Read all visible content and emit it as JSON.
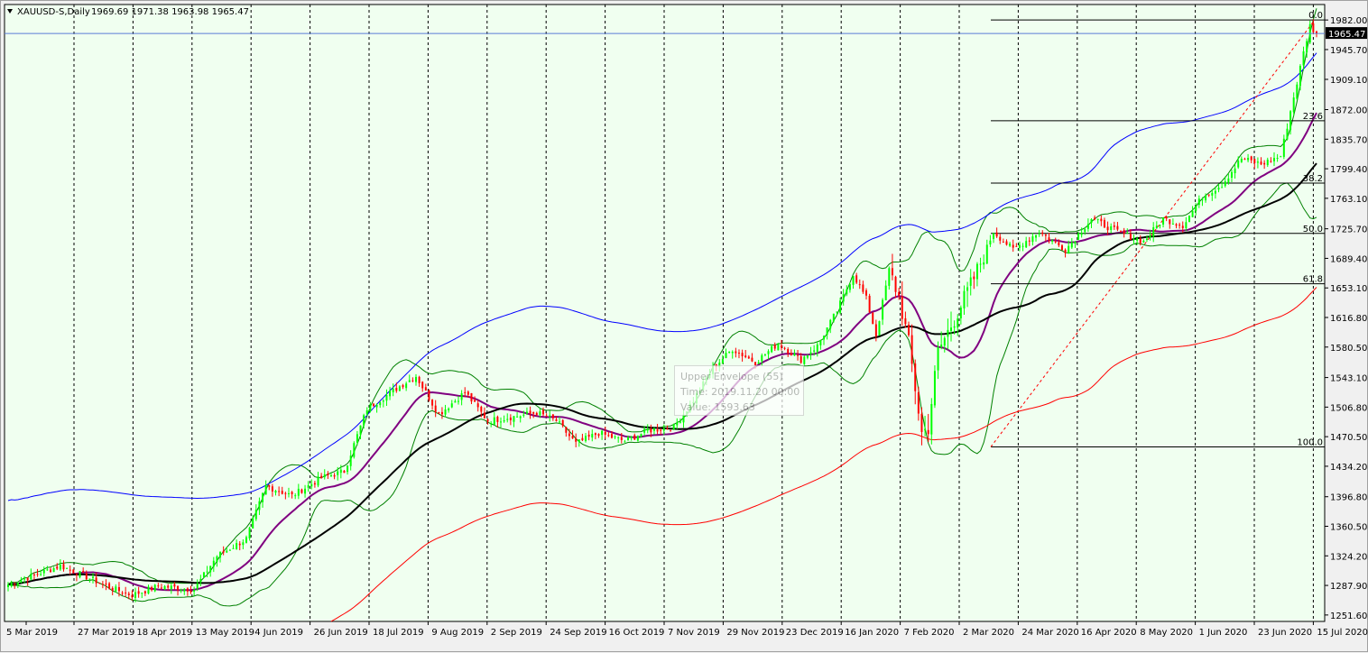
{
  "window": {
    "title": "XAUUSD-S,Daily",
    "ohlc": "1969.69 1971.38 1963.98 1965.47",
    "triangle_icon": "dropdown-triangle-icon"
  },
  "colors": {
    "background": "#f0fff0",
    "candle_up": "#00ff00",
    "candle_down": "#ff0000",
    "ma_fast": "#800080",
    "ma_slow": "#000000",
    "envelope_upper": "#0000ff",
    "envelope_lower": "#ff0000",
    "bollinger": "#008000",
    "fib": "#000000",
    "trend": "#ff0000",
    "grid": "#000000"
  },
  "tooltip": {
    "line1": "Upper Envelope (55)",
    "line2": "Time: 2019.11.20 00:00",
    "line3": "Value: 1593.63"
  },
  "chart_data": {
    "type": "candlestick",
    "symbol": "XAUUSD-S",
    "timeframe": "Daily",
    "last_price": 1965.47,
    "ylim": [
      1243.7,
      2001.0
    ],
    "price_ticks": [
      1982.0,
      1945.7,
      1909.1,
      1872.0,
      1835.7,
      1799.4,
      1763.1,
      1725.7,
      1689.4,
      1653.1,
      1616.8,
      1580.5,
      1543.1,
      1506.8,
      1470.5,
      1434.2,
      1396.8,
      1360.5,
      1324.2,
      1287.9,
      1251.6
    ],
    "date_labels": [
      "5 Mar 2019",
      "27 Mar 2019",
      "18 Apr 2019",
      "13 May 2019",
      "4 Jun 2019",
      "26 Jun 2019",
      "18 Jul 2019",
      "9 Aug 2019",
      "2 Sep 2019",
      "24 Sep 2019",
      "16 Oct 2019",
      "7 Nov 2019",
      "29 Nov 2019",
      "23 Dec 2019",
      "16 Jan 2020",
      "7 Feb 2020",
      "2 Mar 2020",
      "24 Mar 2020",
      "16 Apr 2020",
      "8 May 2020",
      "1 Jun 2020",
      "23 Jun 2020",
      "15 Jul 2020"
    ],
    "close_anchors": [
      {
        "d": 0,
        "v": 1289
      },
      {
        "d": 16,
        "v": 1312
      },
      {
        "d": 22,
        "v": 1302
      },
      {
        "d": 32,
        "v": 1284
      },
      {
        "d": 38,
        "v": 1276
      },
      {
        "d": 46,
        "v": 1287
      },
      {
        "d": 57,
        "v": 1283
      },
      {
        "d": 64,
        "v": 1324
      },
      {
        "d": 73,
        "v": 1345
      },
      {
        "d": 79,
        "v": 1410
      },
      {
        "d": 87,
        "v": 1398
      },
      {
        "d": 96,
        "v": 1420
      },
      {
        "d": 103,
        "v": 1428
      },
      {
        "d": 110,
        "v": 1505
      },
      {
        "d": 121,
        "v": 1535
      },
      {
        "d": 125,
        "v": 1545
      },
      {
        "d": 132,
        "v": 1498
      },
      {
        "d": 140,
        "v": 1525
      },
      {
        "d": 147,
        "v": 1490
      },
      {
        "d": 155,
        "v": 1495
      },
      {
        "d": 162,
        "v": 1500
      },
      {
        "d": 168,
        "v": 1490
      },
      {
        "d": 174,
        "v": 1462
      },
      {
        "d": 181,
        "v": 1475
      },
      {
        "d": 189,
        "v": 1465
      },
      {
        "d": 196,
        "v": 1478
      },
      {
        "d": 204,
        "v": 1482
      },
      {
        "d": 210,
        "v": 1515
      },
      {
        "d": 216,
        "v": 1555
      },
      {
        "d": 222,
        "v": 1578
      },
      {
        "d": 229,
        "v": 1562
      },
      {
        "d": 236,
        "v": 1585
      },
      {
        "d": 243,
        "v": 1565
      },
      {
        "d": 248,
        "v": 1582
      },
      {
        "d": 254,
        "v": 1625
      },
      {
        "d": 259,
        "v": 1670
      },
      {
        "d": 263,
        "v": 1640
      },
      {
        "d": 266,
        "v": 1595
      },
      {
        "d": 270,
        "v": 1675
      },
      {
        "d": 273,
        "v": 1642
      },
      {
        "d": 276,
        "v": 1585
      },
      {
        "d": 280,
        "v": 1475
      },
      {
        "d": 282,
        "v": 1482
      },
      {
        "d": 285,
        "v": 1575
      },
      {
        "d": 290,
        "v": 1615
      },
      {
        "d": 296,
        "v": 1665
      },
      {
        "d": 302,
        "v": 1722
      },
      {
        "d": 308,
        "v": 1700
      },
      {
        "d": 316,
        "v": 1722
      },
      {
        "d": 324,
        "v": 1700
      },
      {
        "d": 332,
        "v": 1738
      },
      {
        "d": 340,
        "v": 1722
      },
      {
        "d": 348,
        "v": 1710
      },
      {
        "d": 354,
        "v": 1738
      },
      {
        "d": 360,
        "v": 1730
      },
      {
        "d": 366,
        "v": 1765
      },
      {
        "d": 372,
        "v": 1780
      },
      {
        "d": 378,
        "v": 1812
      },
      {
        "d": 384,
        "v": 1805
      },
      {
        "d": 390,
        "v": 1815
      },
      {
        "d": 393,
        "v": 1870
      },
      {
        "d": 395,
        "v": 1905
      },
      {
        "d": 397,
        "v": 1942
      },
      {
        "d": 399,
        "v": 1975
      },
      {
        "d": 401,
        "v": 1965.47
      }
    ],
    "fibonacci": {
      "high": 1982.0,
      "low": 1458.0,
      "levels": [
        {
          "label": "0.0",
          "value": 1982.0
        },
        {
          "label": "23.6",
          "value": 1858.3
        },
        {
          "label": "38.2",
          "value": 1781.8
        },
        {
          "label": "50.0",
          "value": 1720.0
        },
        {
          "label": "61.8",
          "value": 1658.2
        },
        {
          "label": "100.0",
          "value": 1458.0
        }
      ]
    },
    "indicators": [
      "Moving Average (fast)",
      "Moving Average (slow)",
      "Envelopes (55)",
      "Bollinger Bands"
    ],
    "grid": "vertical-dashed"
  }
}
